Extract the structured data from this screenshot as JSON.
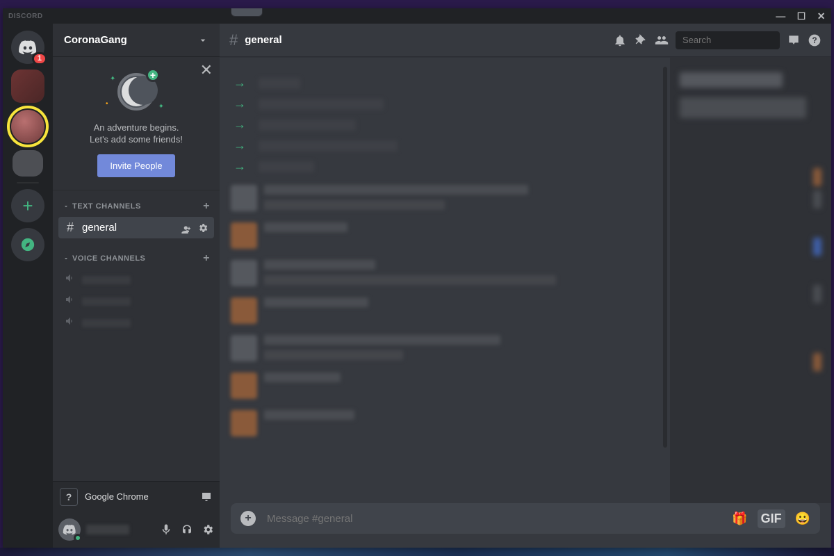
{
  "app": {
    "name": "DISCORD"
  },
  "window_controls": {
    "min": "—",
    "max": "☐",
    "close": "✕"
  },
  "servers": {
    "home_badge": "1",
    "add_label": "+",
    "explore_label": "explore"
  },
  "server_header": {
    "name": "CoronaGang"
  },
  "welcome": {
    "line1": "An adventure begins.",
    "line2": "Let's add some friends!",
    "button": "Invite People",
    "close": "✕"
  },
  "sections": {
    "text": {
      "label": "TEXT CHANNELS",
      "add": "+"
    },
    "voice": {
      "label": "VOICE CHANNELS",
      "add": "+"
    }
  },
  "channels": {
    "general": "general"
  },
  "activity": {
    "app": "Google Chrome",
    "icon_char": "?"
  },
  "chat_header": {
    "channel": "general"
  },
  "search": {
    "placeholder": "Search"
  },
  "composer": {
    "placeholder": "Message #general",
    "gif_label": "GIF"
  },
  "icons": {
    "hash": "#",
    "speaker": "🔊",
    "bell": "bell",
    "pin": "pin",
    "members": "members",
    "inbox": "inbox",
    "help": "?",
    "gift": "🎁",
    "emoji": "😀",
    "screen": "⇪",
    "add_circle": "+",
    "chevron_down": "⌄",
    "arrow": "→"
  }
}
